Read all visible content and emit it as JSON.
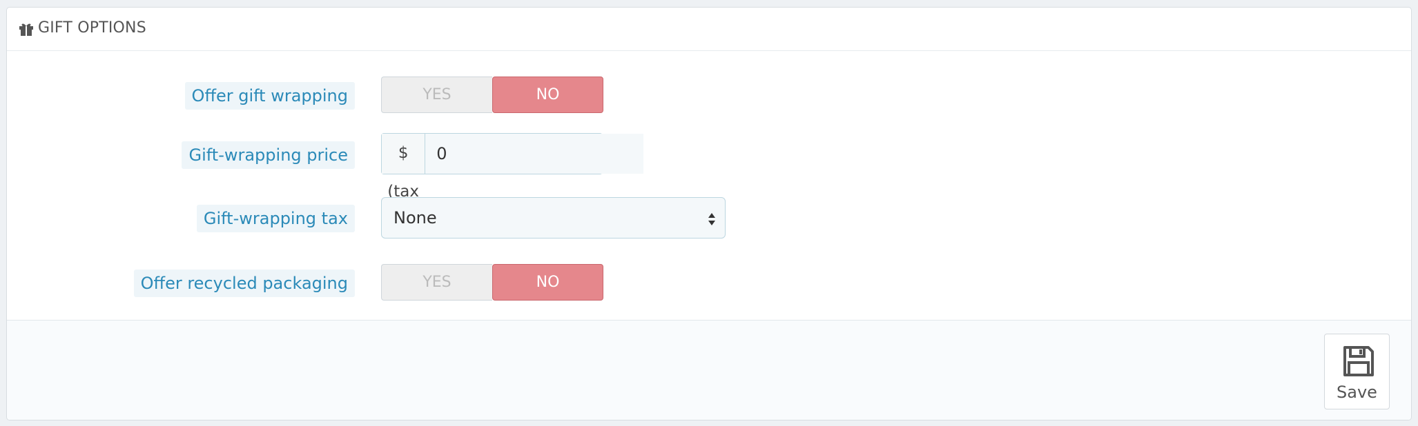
{
  "panel": {
    "title": "GIFT OPTIONS",
    "icon": "gift-icon"
  },
  "fields": {
    "offer_gift_wrapping": {
      "label": "Offer gift wrapping",
      "yes": "YES",
      "no": "NO",
      "selected": "NO"
    },
    "gift_wrapping_price": {
      "label": "Gift-wrapping price",
      "addon": "$ (tax excl.)",
      "value": "0"
    },
    "gift_wrapping_tax": {
      "label": "Gift-wrapping tax",
      "selected": "None"
    },
    "offer_recycled_packaging": {
      "label": "Offer recycled packaging",
      "yes": "YES",
      "no": "NO",
      "selected": "NO"
    }
  },
  "footer": {
    "save_label": "Save",
    "save_icon": "floppy-disk-icon"
  },
  "colors": {
    "label_text": "#2b8ab8",
    "toggle_no_active": "#e5878c"
  }
}
